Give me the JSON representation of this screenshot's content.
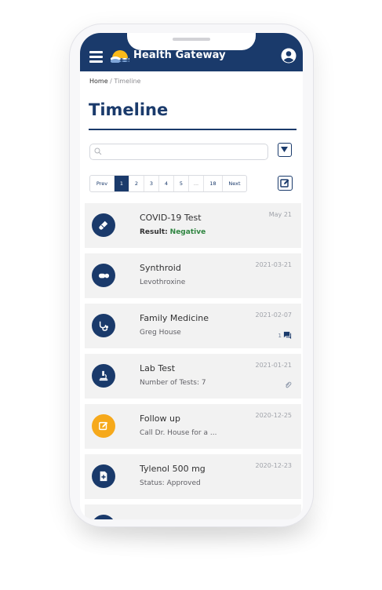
{
  "header": {
    "title": "Health Gateway"
  },
  "breadcrumb": {
    "home": "Home",
    "separator": "/",
    "current": "Timeline"
  },
  "page": {
    "title": "Timeline"
  },
  "search": {
    "value": "",
    "placeholder": ""
  },
  "pagination": {
    "prev": "Prev",
    "pages": [
      "1",
      "2",
      "3",
      "4",
      "5",
      "...",
      "18"
    ],
    "active_page": "1",
    "next": "Next"
  },
  "entries": [
    {
      "icon": "test-tube-icon",
      "title": "COVID-19 Test",
      "sub_label": "Result:",
      "sub_value": "Negative",
      "date": "May 21"
    },
    {
      "icon": "pill-icon",
      "title": "Synthroid",
      "subtitle": "Levothroxine",
      "date": "2021-03-21"
    },
    {
      "icon": "stethoscope-icon",
      "title": "Family Medicine",
      "subtitle": "Greg House",
      "date": "2021-02-07",
      "comment_count": "1"
    },
    {
      "icon": "microscope-icon",
      "title": "Lab Test",
      "subtitle": "Number of Tests: 7",
      "date": "2021-01-21"
    },
    {
      "icon": "edit-note-icon",
      "title": "Follow up",
      "subtitle": "Call Dr. House for a ...",
      "date": "2020-12-25"
    },
    {
      "icon": "file-medical-icon",
      "title": "Tylenol 500 mg",
      "subtitle": "Status: Approved",
      "date": "2020-12-23"
    }
  ],
  "colors": {
    "primary": "#1a3a6b",
    "note_accent": "#f6a91b",
    "success": "#2e8540",
    "card_bg": "#f2f2f2"
  }
}
